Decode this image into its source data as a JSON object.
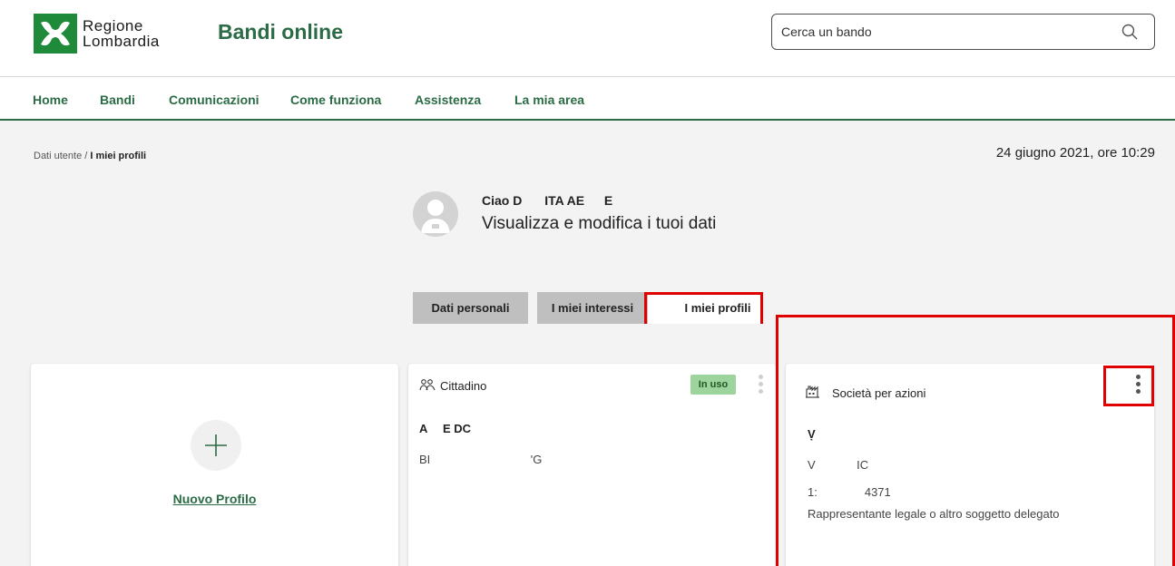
{
  "header": {
    "logo_line1": "Regione",
    "logo_line2": "Lombardia",
    "site_title": "Bandi online",
    "search_placeholder": "Cerca un bando",
    "brand_color": "#2b6b45",
    "logo_color": "#1e8a3a"
  },
  "nav": {
    "items": [
      "Home",
      "Bandi",
      "Comunicazioni",
      "Come funziona",
      "Assistenza",
      "La mia area"
    ]
  },
  "breadcrumb": {
    "parent": "Dati utente",
    "separator": " / ",
    "current": "I miei profili"
  },
  "datetime": "24 giugno 2021, ore 10:29",
  "user": {
    "greeting": "Ciao D    ITA AE    E",
    "subtitle": "Visualizza e modifica i tuoi dati"
  },
  "tabs": [
    {
      "label": "Dati personali",
      "active": false
    },
    {
      "label": "I miei interessi",
      "active": false
    },
    {
      "label": "I miei profili",
      "active": true
    }
  ],
  "cards": {
    "new_profile": {
      "label": "Nuovo Profilo",
      "icon": "plus-icon"
    },
    "cittadino": {
      "title": "Cittadino",
      "badge": "In uso",
      "badge_color": "#9dd39d",
      "name": "A   E DC",
      "code": "BI                 'G"
    },
    "societa": {
      "title": "Società per azioni",
      "line1": "Ṿ",
      "line2": "V       IC",
      "line3": "1:        4371",
      "role": "Rappresentante legale o altro soggetto delegato"
    }
  },
  "highlight_color": "#e00000"
}
